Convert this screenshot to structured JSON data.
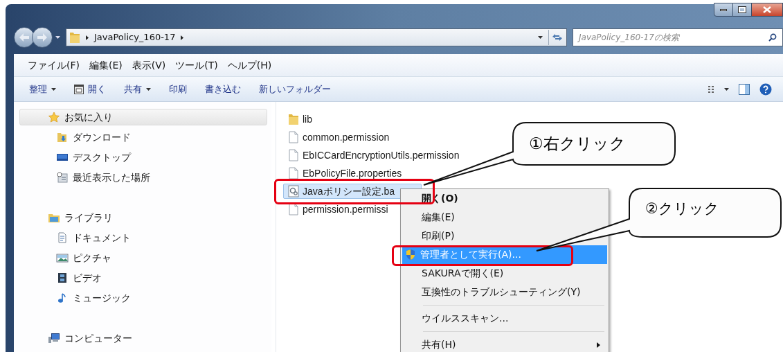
{
  "address_bar": {
    "path": [
      "JavaPolicy_160-17"
    ]
  },
  "search": {
    "placeholder": "JavaPolicy_160-17の検索"
  },
  "menu_bar": [
    "ファイル(F)",
    "編集(E)",
    "表示(V)",
    "ツール(T)",
    "ヘルプ(H)"
  ],
  "toolbar": [
    {
      "label": "整理",
      "kind": "dropdown"
    },
    {
      "label": "開く",
      "kind": "open"
    },
    {
      "label": "共有",
      "kind": "dropdown"
    },
    {
      "label": "印刷",
      "kind": "plain"
    },
    {
      "label": "書き込む",
      "kind": "plain"
    },
    {
      "label": "新しいフォルダー",
      "kind": "plain"
    }
  ],
  "nav": [
    {
      "label": "お気に入り",
      "kind": "star",
      "selected": true,
      "children": [
        {
          "label": "ダウンロード",
          "kind": "download",
          "selected": false
        },
        {
          "label": "デスクトップ",
          "kind": "desktop",
          "selected": false
        },
        {
          "label": "最近表示した場所",
          "kind": "recent",
          "selected": false
        }
      ]
    },
    {
      "label": "ライブラリ",
      "kind": "library",
      "selected": false,
      "children": [
        {
          "label": "ドキュメント",
          "kind": "document",
          "selected": false
        },
        {
          "label": "ピクチャ",
          "kind": "picture",
          "selected": false
        },
        {
          "label": "ビデオ",
          "kind": "video",
          "selected": false
        },
        {
          "label": "ミュージック",
          "kind": "music",
          "selected": false
        }
      ]
    },
    {
      "label": "コンピューター",
      "kind": "computer",
      "selected": false
    }
  ],
  "files": [
    {
      "name": "lib",
      "kind": "folder",
      "selected": false
    },
    {
      "name": "common.permission",
      "kind": "file",
      "selected": false
    },
    {
      "name": "EbICCardEncryptionUtils.permission",
      "kind": "file",
      "selected": false
    },
    {
      "name": "EbPolicyFile.properties",
      "kind": "file",
      "selected": false
    },
    {
      "name": "Javaポリシー設定.ba",
      "kind": "batch",
      "selected": true
    },
    {
      "name": "permission.permissi",
      "kind": "file",
      "selected": false
    }
  ],
  "context_menu": {
    "items": [
      {
        "label": "開く(O)",
        "kind": "default",
        "selected": false
      },
      {
        "label": "編集(E)",
        "kind": "item",
        "selected": false
      },
      {
        "label": "印刷(P)",
        "kind": "item",
        "selected": false
      },
      {
        "label": "管理者として実行(A)...",
        "kind": "admin",
        "selected": true
      },
      {
        "label": "SAKURAで開く(E)",
        "kind": "item",
        "selected": false
      },
      {
        "label": "互換性のトラブルシューティング(Y)",
        "kind": "item",
        "selected": false
      },
      {
        "kind": "separator"
      },
      {
        "label": "ウイルススキャン...",
        "kind": "item",
        "selected": false
      },
      {
        "kind": "separator"
      },
      {
        "label": "共有(H)",
        "kind": "submenu",
        "selected": false
      }
    ]
  },
  "callouts": [
    "①右クリック",
    "②クリック"
  ]
}
